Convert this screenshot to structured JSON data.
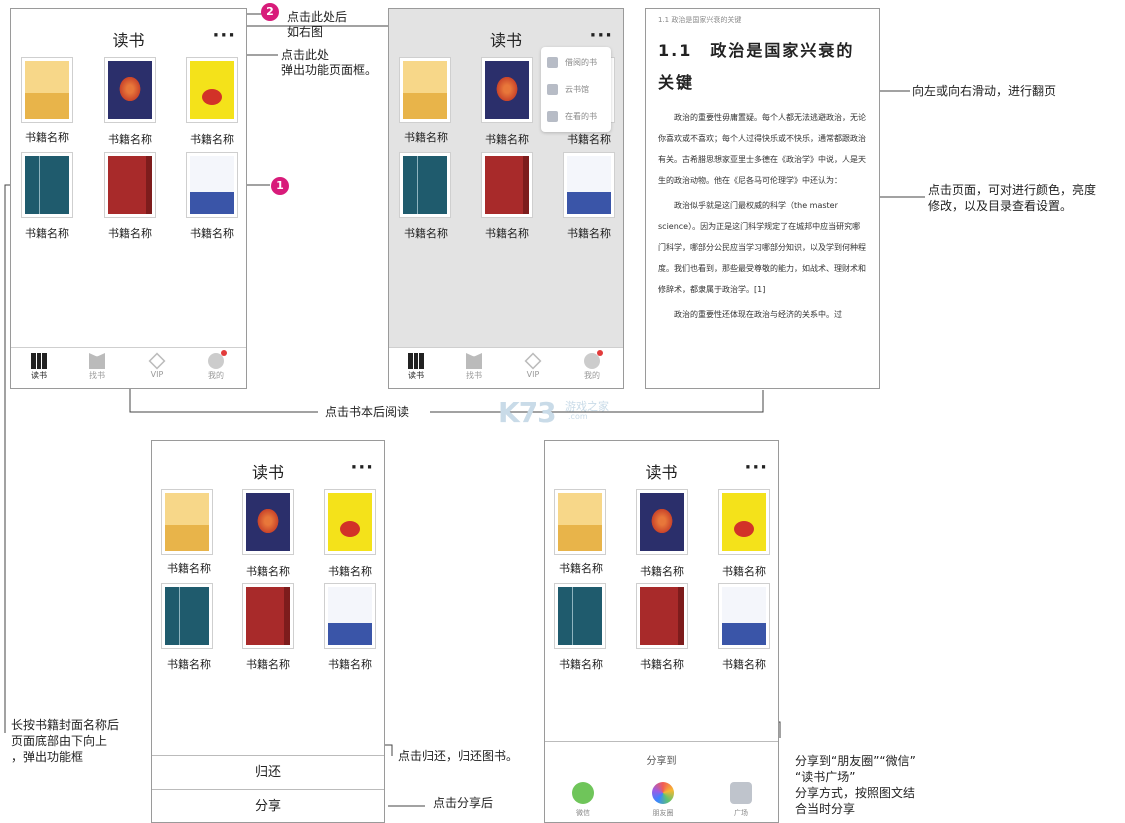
{
  "app_title": "读书",
  "more_symbol": "···",
  "book_title": "书籍名称",
  "tabs": [
    "读书",
    "找书",
    "VIP",
    "我的"
  ],
  "popup_items": [
    "借阅的书",
    "云书馆",
    "在看的书"
  ],
  "reader": {
    "header": "1.1 政治是国家兴衰的关键",
    "title": "1.1　政治是国家兴衰的关键",
    "paragraphs": [
      "政治的重要性毋庸置疑。每个人都无法逃避政治，无论你喜欢或不喜欢；每个人过得快乐或不快乐，通常都跟政治有关。古希腊思想家亚里士多德在《政治学》中说，人是天生的政治动物。他在《尼各马可伦理学》中还认为：",
      "政治似乎就是这门最权威的科学（the master science）。因为正是这门科学规定了在城邦中应当研究哪门科学，哪部分公民应当学习哪部分知识，以及学到何种程度。我们也看到，那些最受尊敬的能力，如战术、理财术和修辞术，都隶属于政治学。[1]",
      "政治的重要性还体现在政治与经济的关系中。过"
    ]
  },
  "sheet": {
    "return_label": "归还",
    "share_label": "分享"
  },
  "share": {
    "title": "分享到",
    "options": [
      "微信",
      "朋友圈",
      "广场"
    ]
  },
  "annotations": {
    "badge1": "1",
    "badge2": "2",
    "click_here_after": "点击此处后",
    "as_right": "如右图",
    "click_here": "点击此处",
    "popup_frame": "弹出功能页面框。",
    "swipe": "向左或向右滑动，进行翻页",
    "tap_page_1": "点击页面，可对进行颜色，亮度",
    "tap_page_2": "修改，以及目录查看设置。",
    "tap_book": "点击书本后阅读",
    "long_press_1": "长按书籍封面名称后",
    "long_press_2": "页面底部由下向上",
    "long_press_3": "，弹出功能框",
    "return_note": "点击归还，归还图书。",
    "share_note": "点击分享后",
    "share_to_1": "分享到“朋友圈”“微信”",
    "share_to_2": "“读书广场”",
    "share_to_3": "分享方式，按照图文结",
    "share_to_4": "合当时分享"
  },
  "watermark": {
    "logo": "K73",
    "site": "游戏之家",
    "domain": ".com"
  },
  "colors": {
    "badge": "#d81b7a",
    "dim_background": "#e3e3e3"
  }
}
